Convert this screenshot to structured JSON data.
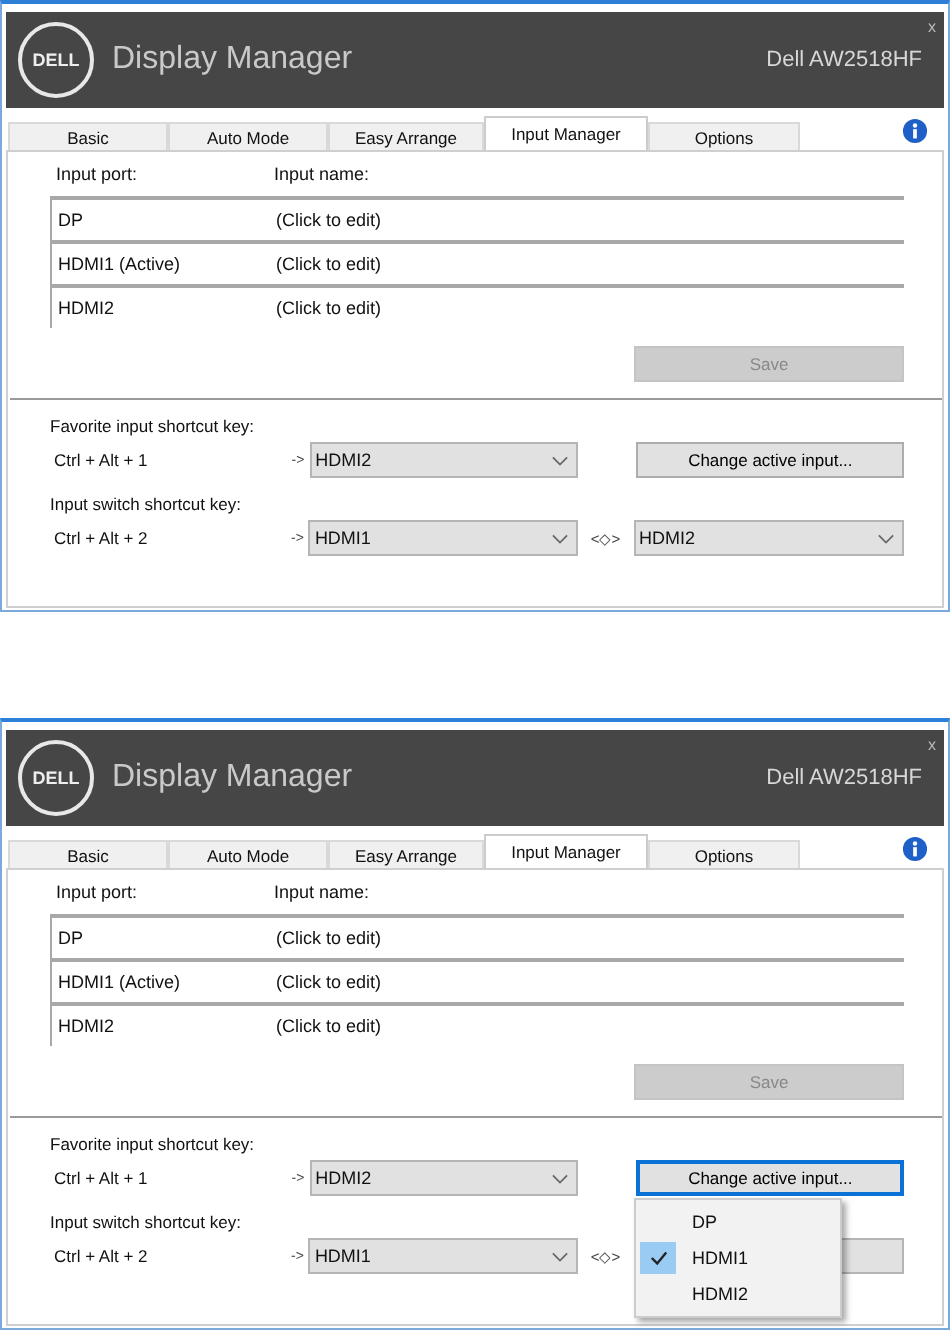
{
  "windows": [
    {
      "logo": "DELL",
      "title": "Display Manager",
      "monitor": "Dell AW2518HF",
      "close": "x",
      "tabs": [
        {
          "label": "Basic",
          "selected": false
        },
        {
          "label": "Auto Mode",
          "selected": false
        },
        {
          "label": "Easy Arrange",
          "selected": false
        },
        {
          "label": "Input Manager",
          "selected": true
        },
        {
          "label": "Options",
          "selected": false
        }
      ],
      "ports_header": {
        "port": "Input port:",
        "name": "Input name:"
      },
      "ports": [
        {
          "port": "DP",
          "name": "(Click to edit)"
        },
        {
          "port": "HDMI1 (Active)",
          "name": "(Click to edit)"
        },
        {
          "port": "HDMI2",
          "name": "(Click to edit)"
        }
      ],
      "save": {
        "label": "Save",
        "disabled": true
      },
      "favorite": {
        "label": "Favorite input shortcut key:",
        "keys": "Ctrl + Alt + 1",
        "arrow": "->",
        "value": "HDMI2"
      },
      "change_button": {
        "label": "Change active input...",
        "focused": false
      },
      "switch": {
        "label": "Input switch shortcut key:",
        "keys": "Ctrl + Alt + 2",
        "arrow": "->",
        "value_a": "HDMI1",
        "swap": "<◇>",
        "value_b": "HDMI2"
      }
    },
    {
      "logo": "DELL",
      "title": "Display Manager",
      "monitor": "Dell AW2518HF",
      "close": "x",
      "tabs": [
        {
          "label": "Basic",
          "selected": false
        },
        {
          "label": "Auto Mode",
          "selected": false
        },
        {
          "label": "Easy Arrange",
          "selected": false
        },
        {
          "label": "Input Manager",
          "selected": true
        },
        {
          "label": "Options",
          "selected": false
        }
      ],
      "ports_header": {
        "port": "Input port:",
        "name": "Input name:"
      },
      "ports": [
        {
          "port": "DP",
          "name": "(Click to edit)"
        },
        {
          "port": "HDMI1 (Active)",
          "name": "(Click to edit)"
        },
        {
          "port": "HDMI2",
          "name": "(Click to edit)"
        }
      ],
      "save": {
        "label": "Save",
        "disabled": true
      },
      "favorite": {
        "label": "Favorite input shortcut key:",
        "keys": "Ctrl + Alt + 1",
        "arrow": "->",
        "value": "HDMI2"
      },
      "change_button": {
        "label": "Change active input...",
        "focused": true
      },
      "switch": {
        "label": "Input switch shortcut key:",
        "keys": "Ctrl + Alt + 2",
        "arrow": "->",
        "value_a": "HDMI1",
        "swap": "<◇>"
      },
      "menu": [
        {
          "label": "DP",
          "checked": false
        },
        {
          "label": "HDMI1",
          "checked": true
        },
        {
          "label": "HDMI2",
          "checked": false
        }
      ]
    }
  ]
}
